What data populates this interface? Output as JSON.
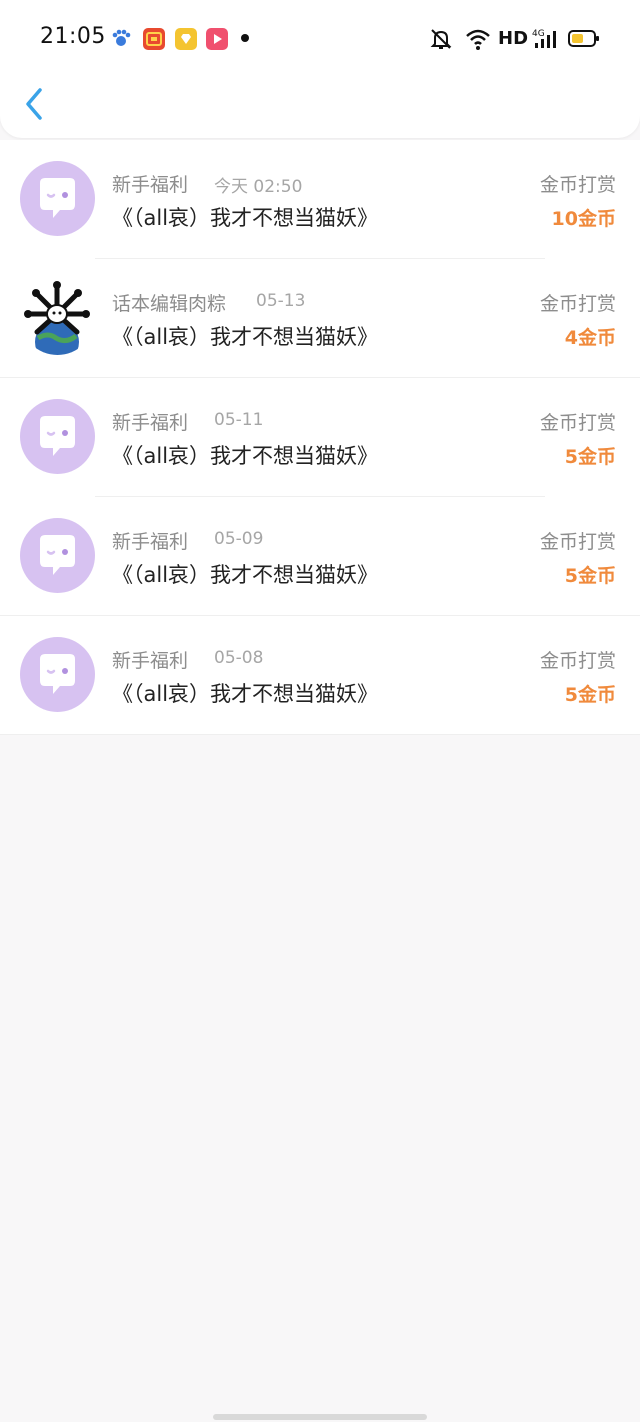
{
  "status_bar": {
    "time": "21:05",
    "network_label": "HD"
  },
  "colors": {
    "accent_back": "#3aa3e8",
    "amount": "#f08a3c",
    "avatar_purple": "#d7c2f1"
  },
  "messages": [
    {
      "sender": "新手福利",
      "date": "今天 02:50",
      "title": "《（all哀）我才不想当猫妖》",
      "type": "金币打赏",
      "amount": "10金币",
      "avatar": "chat-bubble-icon"
    },
    {
      "sender": "话本编辑肉粽",
      "date": "05-13",
      "title": "《（all哀）我才不想当猫妖》",
      "type": "金币打赏",
      "amount": "4金币",
      "avatar": "user-photo"
    },
    {
      "sender": "新手福利",
      "date": "05-11",
      "title": "《（all哀）我才不想当猫妖》",
      "type": "金币打赏",
      "amount": "5金币",
      "avatar": "chat-bubble-icon"
    },
    {
      "sender": "新手福利",
      "date": "05-09",
      "title": "《（all哀）我才不想当猫妖》",
      "type": "金币打赏",
      "amount": "5金币",
      "avatar": "chat-bubble-icon"
    },
    {
      "sender": "新手福利",
      "date": "05-08",
      "title": "《（all哀）我才不想当猫妖》",
      "type": "金币打赏",
      "amount": "5金币",
      "avatar": "chat-bubble-icon"
    }
  ]
}
